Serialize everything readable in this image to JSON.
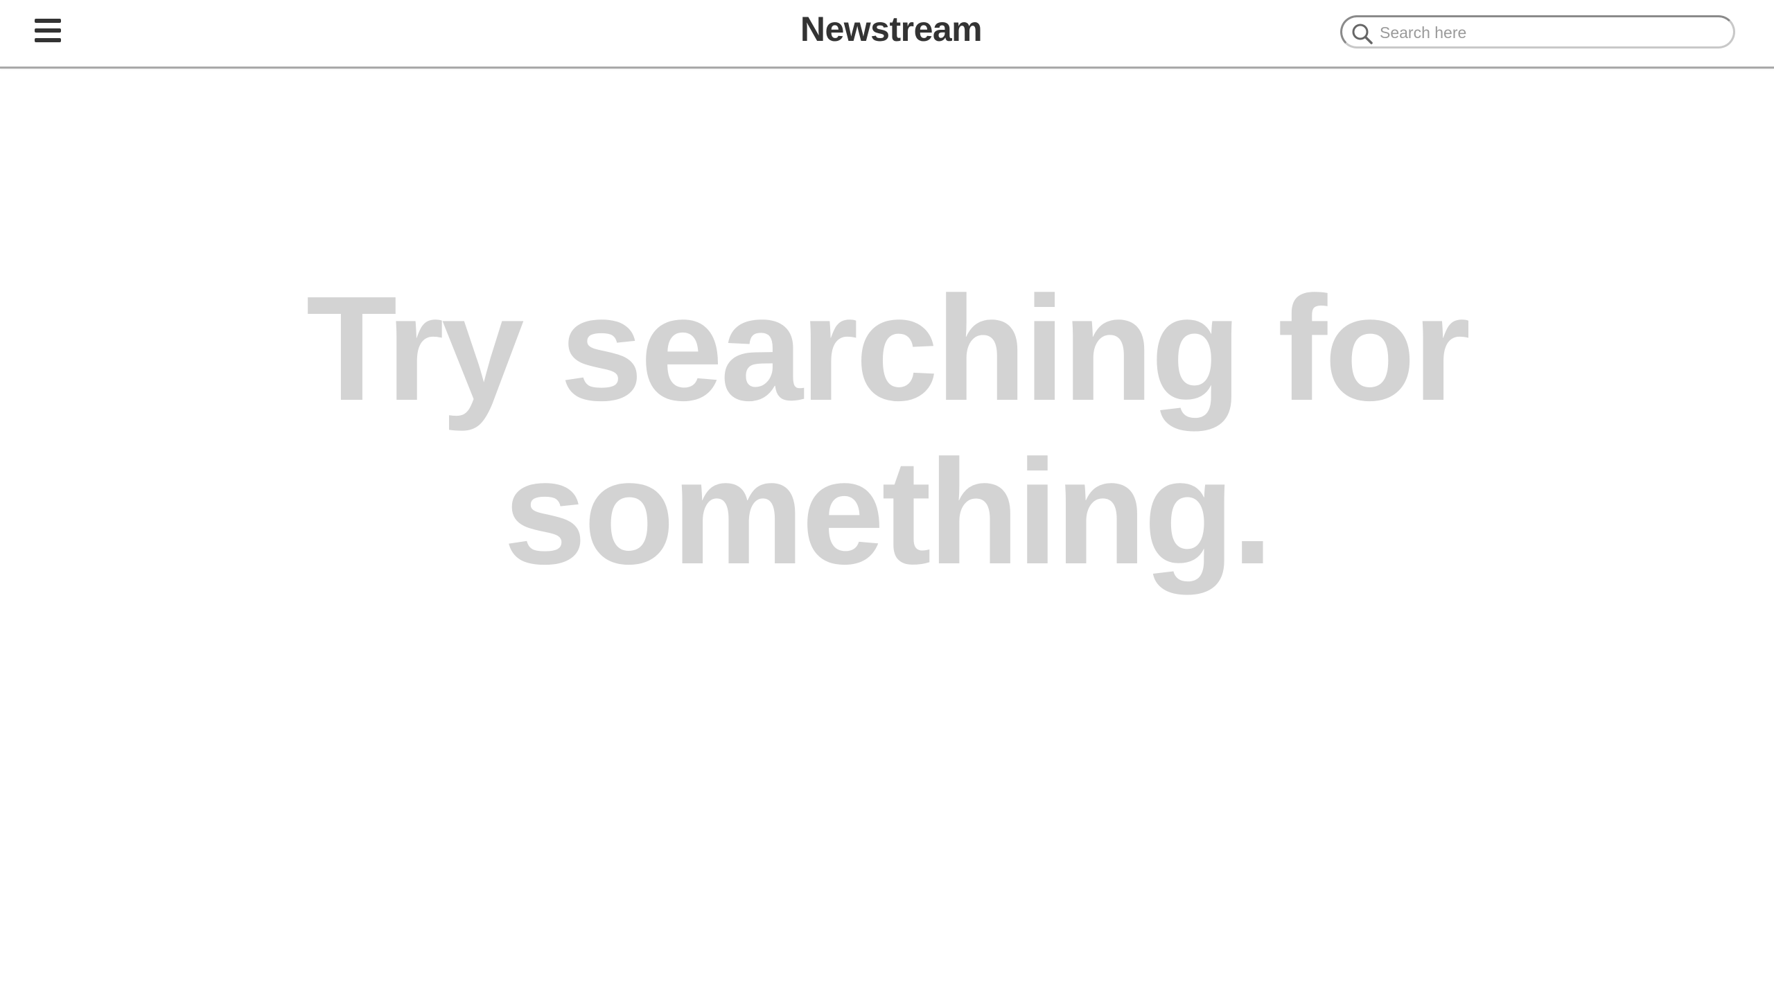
{
  "header": {
    "menu_icon": "hamburger-menu-icon",
    "title": "Newstream",
    "search": {
      "icon": "search-icon",
      "placeholder": "Search here",
      "value": ""
    }
  },
  "main": {
    "message_line1": "Try searching for",
    "message_line2": "something."
  },
  "colors": {
    "title_text": "#333333",
    "message_text": "#d3d3d3",
    "header_border": "#a9a9a9"
  }
}
